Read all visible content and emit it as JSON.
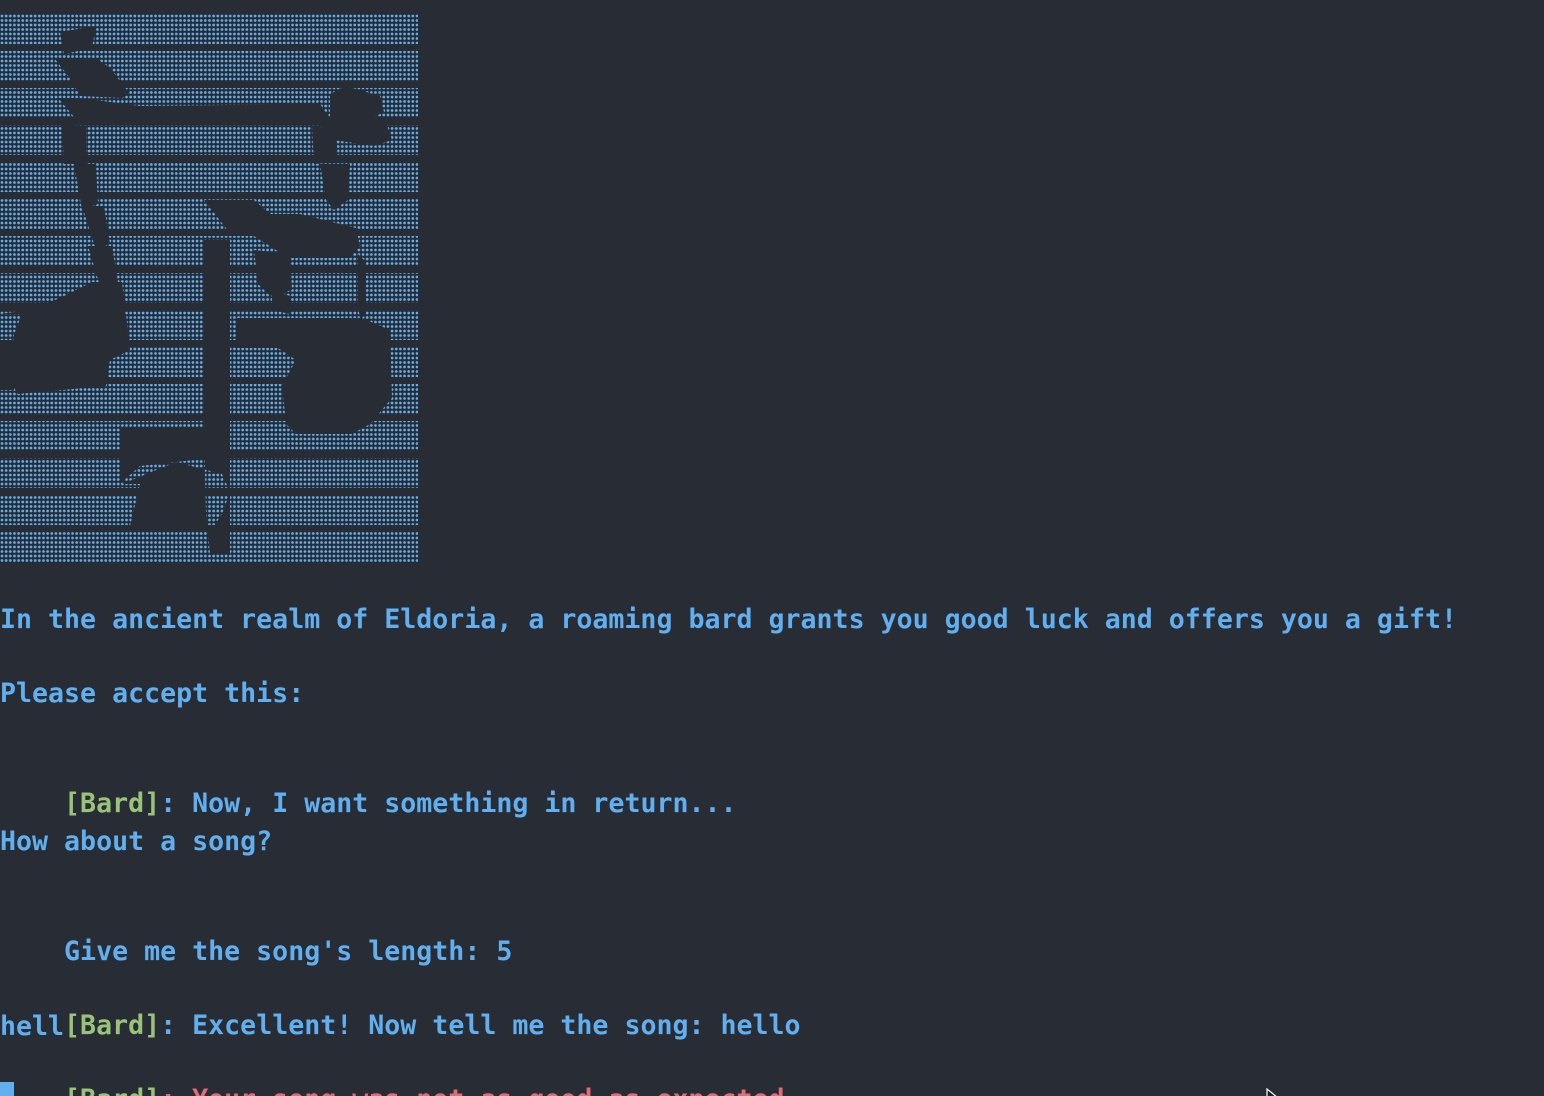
{
  "terminal": {
    "colors": {
      "background": "#282c34",
      "text": "#61afef",
      "tag": "#98c379",
      "error": "#e06c75",
      "art": "#61afef"
    },
    "ascii_art": {
      "description_icon": "bard-ascii-art-icon"
    },
    "lines": {
      "intro": "In the ancient realm of Eldoria, a roaming bard grants you good luck and offers you a gift!",
      "accept": "Please accept this:",
      "return_tag": "[Bard]",
      "return_text": ": Now, I want something in return...",
      "song_question": "How about a song?",
      "length_prompt": "Give me the song's length: ",
      "length_value": "5",
      "excellent_tag": "[Bard]",
      "excellent_text": ": Excellent! Now tell me the song: ",
      "song_input": "hello",
      "echo": "hell",
      "result_tag": "[Bard]",
      "result_text": ": Your song was not as good as expected..."
    }
  }
}
